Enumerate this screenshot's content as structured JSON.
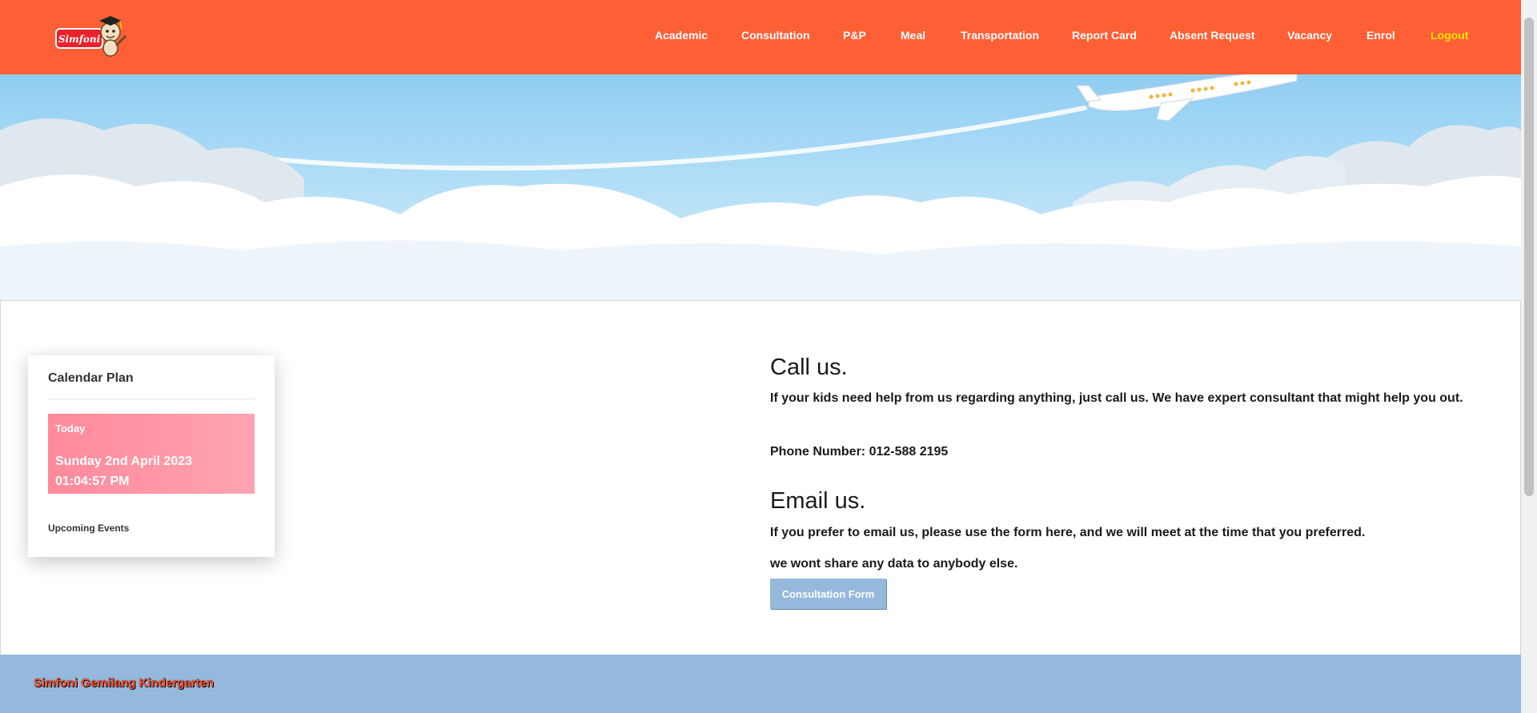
{
  "brand": {
    "logo_text": "Simfoni"
  },
  "nav": {
    "items": [
      {
        "label": "Academic"
      },
      {
        "label": "Consultation"
      },
      {
        "label": "P&P"
      },
      {
        "label": "Meal"
      },
      {
        "label": "Transportation"
      },
      {
        "label": "Report Card"
      },
      {
        "label": "Absent Request"
      },
      {
        "label": "Vacancy"
      },
      {
        "label": "Enrol"
      },
      {
        "label": "Logout"
      }
    ]
  },
  "calendar": {
    "title": "Calendar Plan",
    "today_label": "Today",
    "today_date": "Sunday 2nd April 2023",
    "today_time": "01:04:57 PM",
    "upcoming_label": "Upcoming Events"
  },
  "contact": {
    "call_heading": "Call us.",
    "call_text": "If your kids need help from us regarding anything, just call us. We have expert consultant that might help you out.",
    "phone_text": "Phone Number: 012-588 2195",
    "email_heading": "Email us.",
    "email_text": "If you prefer to email us, please use the form here, and we will meet at the time that you preferred.",
    "privacy_text": "we wont share any data to anybody else.",
    "button_label": "Consultation Form"
  },
  "footer": {
    "text": "Simfoni Gemilang Kindergarten"
  },
  "colors": {
    "header": "#ff5f34",
    "logout": "#ffe600",
    "today_box": "#ff8a9a",
    "footer": "#94b9dc",
    "footer_text": "#ff5030"
  }
}
